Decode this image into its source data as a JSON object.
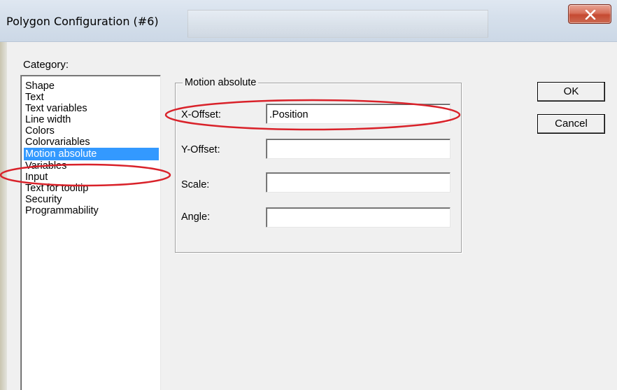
{
  "window": {
    "title": "Polygon Configuration (#6)",
    "close_icon": "close-icon"
  },
  "category": {
    "label": "Category:",
    "items": [
      {
        "label": "Shape",
        "selected": false
      },
      {
        "label": "Text",
        "selected": false
      },
      {
        "label": "Text variables",
        "selected": false
      },
      {
        "label": "Line width",
        "selected": false
      },
      {
        "label": "Colors",
        "selected": false
      },
      {
        "label": "Colorvariables",
        "selected": false
      },
      {
        "label": "Motion absolute",
        "selected": true
      },
      {
        "label": "Variables",
        "selected": false
      },
      {
        "label": "Input",
        "selected": false
      },
      {
        "label": "Text for tooltip",
        "selected": false
      },
      {
        "label": "Security",
        "selected": false
      },
      {
        "label": "Programmability",
        "selected": false
      }
    ]
  },
  "motion": {
    "group_title": "Motion absolute",
    "fields": [
      {
        "label": "X-Offset:",
        "value": ".Position"
      },
      {
        "label": "Y-Offset:",
        "value": ""
      },
      {
        "label": "Scale:",
        "value": ""
      },
      {
        "label": "Angle:",
        "value": ""
      }
    ]
  },
  "buttons": {
    "ok": "OK",
    "cancel": "Cancel"
  },
  "colors": {
    "selection": "#3399ff",
    "annotation": "#d9222a",
    "close_button": "#c64a32"
  }
}
